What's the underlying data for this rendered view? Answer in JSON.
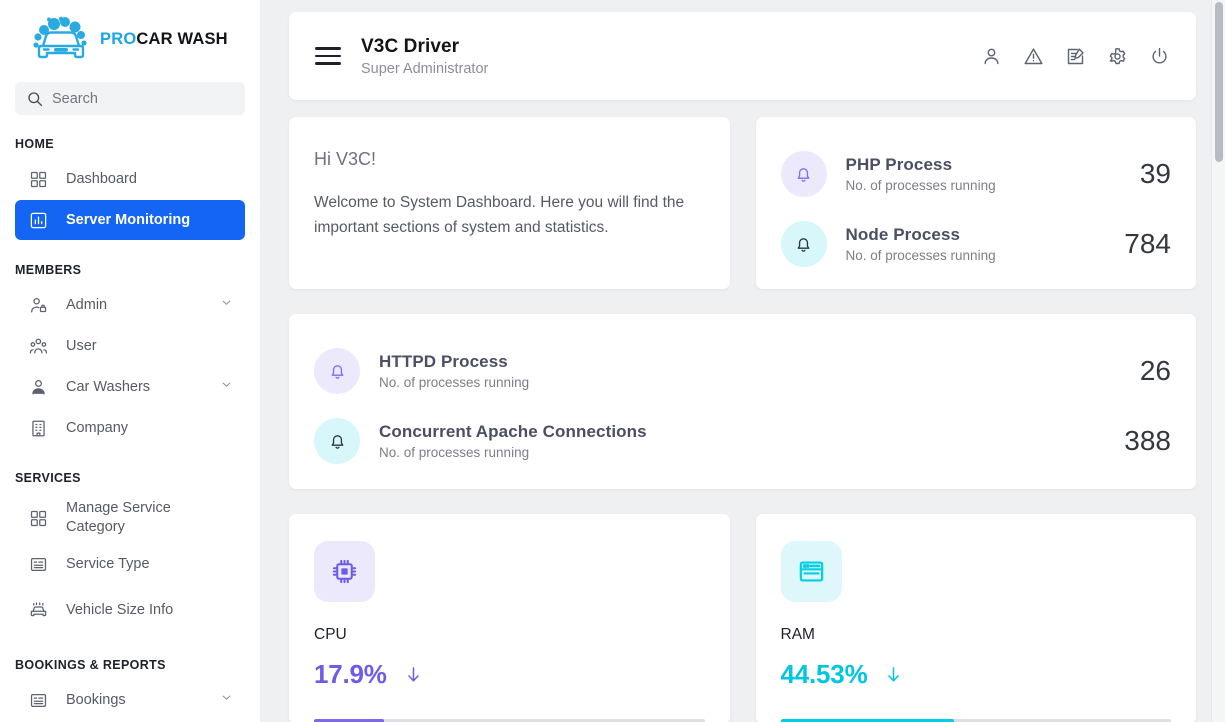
{
  "brand": {
    "logo_icon": "car-wash-logo-icon",
    "name_accent": "PRO",
    "name_rest": "CAR WASH",
    "accent_color": "#19a6e8"
  },
  "search": {
    "placeholder": "Search",
    "value": "",
    "icon": "search-icon"
  },
  "sidebar": {
    "sections": [
      {
        "label": "HOME",
        "items": [
          {
            "label": "Dashboard",
            "icon": "grid-dashboard-icon",
            "active": false,
            "expandable": false
          },
          {
            "label": "Server Monitoring",
            "icon": "bar-chart-icon",
            "active": true,
            "expandable": false
          }
        ]
      },
      {
        "label": "MEMBERS",
        "items": [
          {
            "label": "Admin",
            "icon": "user-lock-icon",
            "active": false,
            "expandable": true
          },
          {
            "label": "User",
            "icon": "users-group-icon",
            "active": false,
            "expandable": false
          },
          {
            "label": "Car Washers",
            "icon": "user-worker-icon",
            "active": false,
            "expandable": true
          },
          {
            "label": "Company",
            "icon": "building-icon",
            "active": false,
            "expandable": false
          }
        ]
      },
      {
        "label": "SERVICES",
        "items": [
          {
            "label": "Manage Service Category",
            "icon": "grid-dashboard-icon",
            "active": false,
            "expandable": false
          },
          {
            "label": "Service Type",
            "icon": "list-card-icon",
            "active": false,
            "expandable": false
          },
          {
            "label": "Vehicle Size Info",
            "icon": "car-wash-vehicle-icon",
            "active": false,
            "expandable": false
          }
        ]
      },
      {
        "label": "BOOKINGS & REPORTS",
        "items": [
          {
            "label": "Bookings",
            "icon": "list-card-icon",
            "active": false,
            "expandable": true
          }
        ]
      }
    ]
  },
  "header": {
    "menu_icon": "hamburger-menu-icon",
    "title": "V3C Driver",
    "subtitle": "Super Administrator",
    "icons": [
      {
        "name": "user-profile-icon"
      },
      {
        "name": "warning-triangle-icon"
      },
      {
        "name": "edit-document-icon"
      },
      {
        "name": "gear-settings-icon"
      },
      {
        "name": "power-logout-icon"
      }
    ]
  },
  "welcome": {
    "greeting": "Hi V3C!",
    "message": "Welcome to System Dashboard. Here you will find the important sections of system and statistics."
  },
  "processes": {
    "card_one": [
      {
        "icon": "bell-icon",
        "icon_tone": "purple",
        "name": "PHP Process",
        "subtitle": "No. of processes running",
        "value": "39"
      },
      {
        "icon": "bell-icon",
        "icon_tone": "cyan",
        "name": "Node Process",
        "subtitle": "No. of processes running",
        "value": "784"
      }
    ],
    "card_two": [
      {
        "icon": "bell-icon",
        "icon_tone": "purple",
        "name": "HTTPD Process",
        "subtitle": "No. of processes running",
        "value": "26"
      },
      {
        "icon": "bell-icon",
        "icon_tone": "cyan",
        "name": "Concurrent Apache Connections",
        "subtitle": "No. of processes running",
        "value": "388"
      }
    ]
  },
  "gauges": [
    {
      "icon": "cpu-chip-icon",
      "label": "CPU",
      "value": "17.9%",
      "percent": 17.9,
      "trend_icon": "arrow-down-icon",
      "color": "#6c5ce7"
    },
    {
      "icon": "memory-window-icon",
      "label": "RAM",
      "value": "44.53%",
      "percent": 44.53,
      "trend_icon": "arrow-down-icon",
      "color": "#00c6e0"
    }
  ]
}
